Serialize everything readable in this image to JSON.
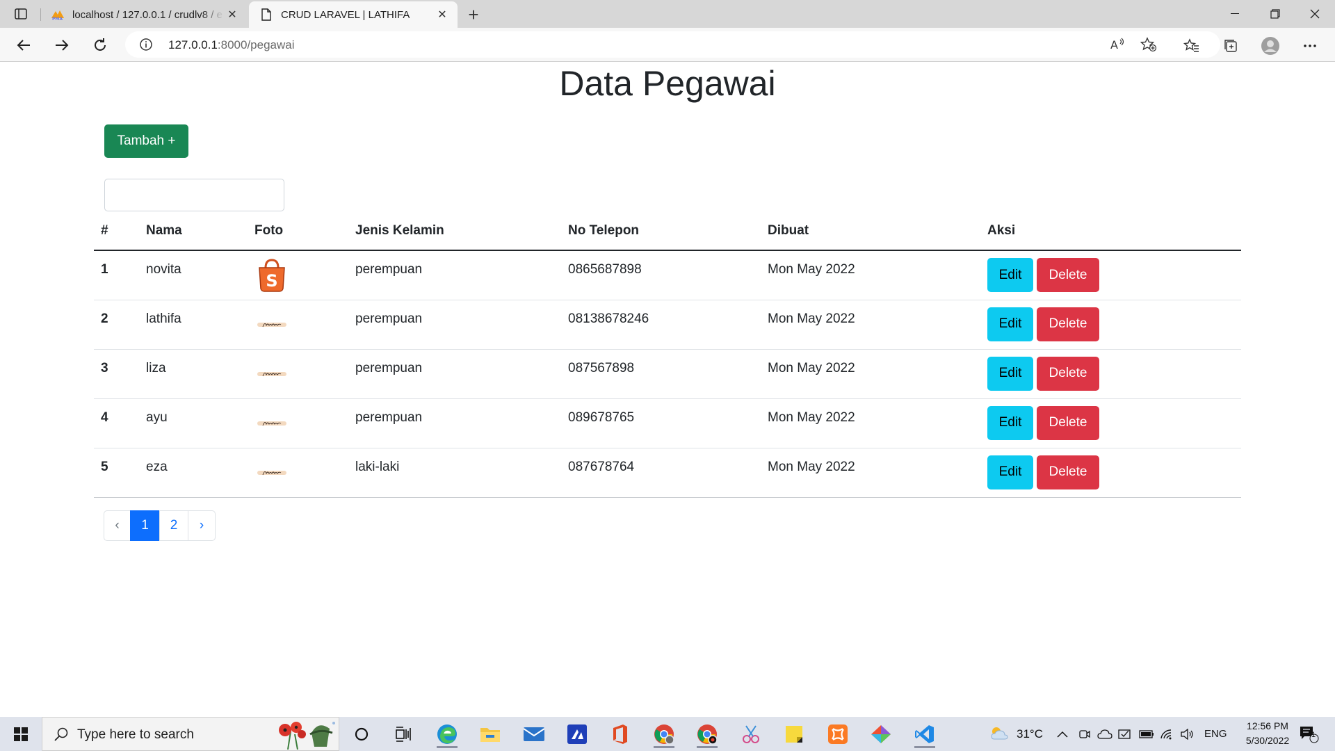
{
  "browser": {
    "tabs": [
      {
        "title": "localhost / 127.0.0.1 / crudlv8 / e",
        "favicon": "phpmyadmin-icon"
      },
      {
        "title": "CRUD LARAVEL | LATHIFA",
        "favicon": "page-icon"
      }
    ],
    "url_host": "127.0.0.1",
    "url_rest": ":8000/pegawai"
  },
  "page": {
    "title": "Data Pegawai",
    "add_button": "Tambah +",
    "search_value": "",
    "table": {
      "headers": [
        "#",
        "Nama",
        "Foto",
        "Jenis Kelamin",
        "No Telepon",
        "Dibuat",
        "Aksi"
      ],
      "rows": [
        {
          "no": "1",
          "nama": "novita",
          "foto": "shopee-bag-icon",
          "jenis_kelamin": "perempuan",
          "telepon": "0865687898",
          "dibuat": "Mon May 2022"
        },
        {
          "no": "2",
          "nama": "lathifa",
          "foto": "lathifa-signature",
          "jenis_kelamin": "perempuan",
          "telepon": "08138678246",
          "dibuat": "Mon May 2022"
        },
        {
          "no": "3",
          "nama": "liza",
          "foto": "lathifa-signature",
          "jenis_kelamin": "perempuan",
          "telepon": "087567898",
          "dibuat": "Mon May 2022"
        },
        {
          "no": "4",
          "nama": "ayu",
          "foto": "lathifa-signature",
          "jenis_kelamin": "perempuan",
          "telepon": "089678765",
          "dibuat": "Mon May 2022"
        },
        {
          "no": "5",
          "nama": "eza",
          "foto": "lathifa-signature",
          "jenis_kelamin": "laki-laki",
          "telepon": "087678764",
          "dibuat": "Mon May 2022"
        }
      ],
      "edit_label": "Edit",
      "delete_label": "Delete"
    },
    "pagination": {
      "prev": "‹",
      "pages": [
        "1",
        "2"
      ],
      "active": "1",
      "next": "›"
    }
  },
  "taskbar": {
    "search_placeholder": "Type here to search",
    "weather": "31°C",
    "language": "ENG",
    "time": "12:56 PM",
    "date": "5/30/2022",
    "notification_count": "1"
  },
  "colors": {
    "success": "#198754",
    "info": "#0dcaf0",
    "danger": "#dc3545",
    "primary": "#0d6efd"
  }
}
